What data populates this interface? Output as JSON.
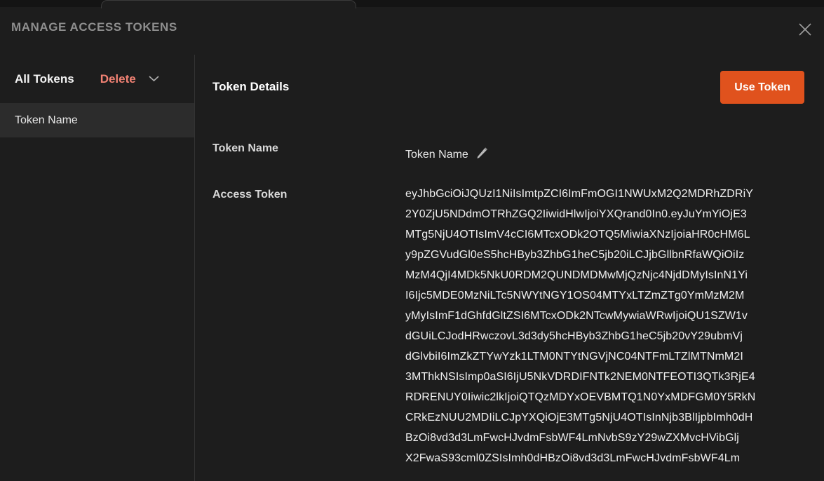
{
  "window": {
    "title": "MANAGE ACCESS TOKENS",
    "close_icon": "close-icon"
  },
  "colors": {
    "background": "#1d1d1d",
    "panel_selected": "#2c2c2c",
    "accent_orange": "#e0521d",
    "danger_salmon": "#f08173",
    "divider": "#333333",
    "title_gray": "#8e8e8e"
  },
  "sidebar": {
    "header": {
      "all_tokens_label": "All Tokens",
      "delete_label": "Delete",
      "chevron_icon": "chevron-down-icon"
    },
    "items": [
      {
        "label": "Token Name",
        "selected": true
      }
    ]
  },
  "detail": {
    "title": "Token Details",
    "use_token_button": "Use Token",
    "fields": {
      "token_name_label": "Token Name",
      "token_name_value": "Token Name",
      "edit_icon": "pencil-edit-icon",
      "access_token_label": "Access Token"
    },
    "access_token_lines": [
      "eyJhbGciOiJQUzI1NiIsImtpZCI6ImFmOGI1NWUxM2Q2MDRhZDRiY",
      "2Y0ZjU5NDdmOTRhZGQ2IiwidHlwIjoiYXQrand0In0.eyJuYmYiOjE3",
      "MTg5NjU4OTIsImV4cCI6MTcxODk2OTQ5MiwiaXNzIjoiaHR0cHM6L",
      "y9pZGVudGl0eS5hcHByb3ZhbG1heC5jb20iLCJjbGllbnRfaWQiOiIz",
      "MzM4QjI4MDk5NkU0RDM2QUNDMDMwMjQzNjc4NjdDMyIsInN1Yi",
      "I6Ijc5MDE0MzNiLTc5NWYtNGY1OS04MTYxLTZmZTg0YmMzM2M",
      "yMyIsImF1dGhfdGltZSI6MTcxODk2NTcwMywiaWRwIjoiQU1SZW1v",
      "dGUiLCJodHRwczovL3d3dy5hcHByb3ZhbG1heC5jb20vY29ubmVj",
      "dGlvbiI6ImZkZTYwYzk1LTM0NTYtNGVjNC04NTFmLTZlMTNmM2I",
      "3MThkNSIsImp0aSI6IjU5NkVDRDIFNTk2NEM0NTFEOTI3QTk3RjE4",
      "RDRENUY0Iiwic2lkIjoiQTQzMDYxOEVBMTQ1N0YxMDFGM0Y5RkN",
      "CRkEzNUU2MDIiLCJpYXQiOjE3MTg5NjU4OTIsInNjb3BlIjpbImh0dH",
      "BzOi8vd3d3LmFwcHJvdmFsbWF4LmNvbS9zY29wZXMvcHVibGlj",
      "X2FwaS93cml0ZSIsImh0dHBzOi8vd3d3LmFwcHJvdmFsbWF4Lm"
    ]
  }
}
